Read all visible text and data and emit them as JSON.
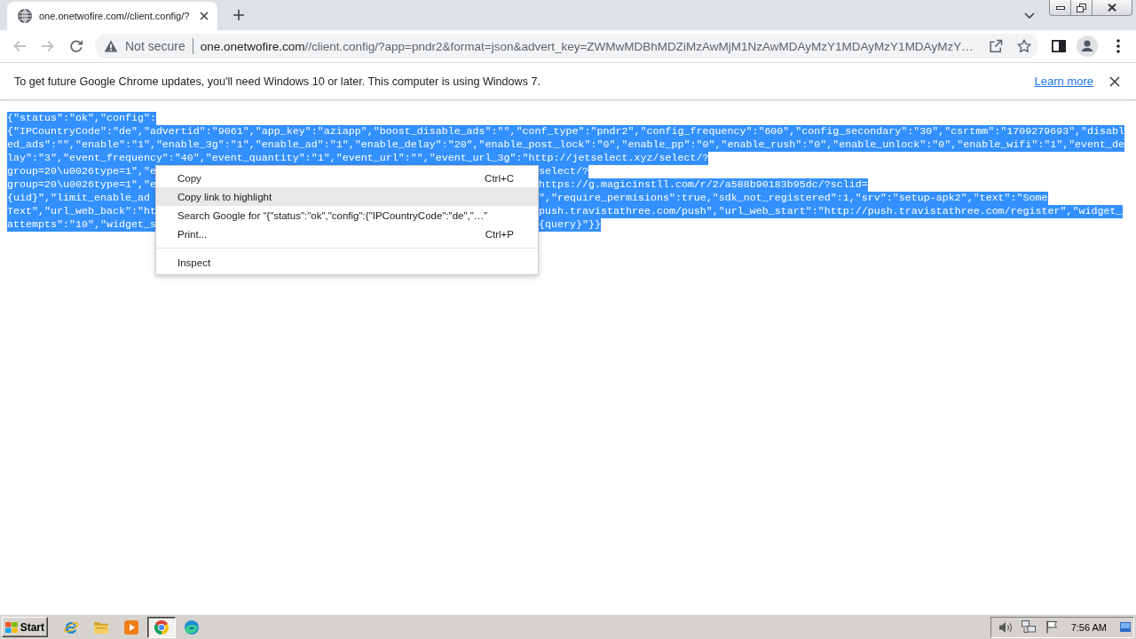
{
  "tabs": [
    {
      "title": "one.onetwofire.com//client.config/?",
      "selected": true
    }
  ],
  "toolbar": {
    "back": {
      "disabled": true
    },
    "forward": {
      "disabled": true
    }
  },
  "address_bar": {
    "security_label": "Not secure",
    "url_host": "one.onetwofire.com",
    "url_rest": "//client.config/?app=pndr2&format=json&advert_key=ZWMwMDBhMDZiMzAwMjM1NzAwMDAyMzY1MDAyMzY1MDAyMzY…"
  },
  "info_bar": {
    "message": "To get future Google Chrome updates, you'll need Windows 10 or later. This computer is using Windows 7.",
    "link": "Learn more"
  },
  "page": {
    "highlighted": true,
    "lines": [
      {
        "kind": "full",
        "text": "{\"status\":\"ok\",\"config\":"
      },
      {
        "kind": "full",
        "text": "{\"IPCountryCode\":\"de\",\"advertid\":\"9061\",\"app_key\":\"aziapp\",\"boost_disable_ads\":\"\",\"conf_type\":\"pndr2\",\"config_frequency\":\"600\",\"config_secondary\":\"30\",\"csrtmm\":\"1709279693\",\"disabl"
      },
      {
        "kind": "full",
        "text": "ed_ads\":\"\",\"enable\":\"1\",\"enable_3g\":\"1\",\"enable_ad\":\"1\",\"enable_delay\":\"20\",\"enable_post_lock\":\"0\",\"enable_pp\":\"0\",\"enable_rush\":\"0\",\"enable_unlock\":\"0\",\"enable_wifi\":\"1\",\"event_de"
      },
      {
        "kind": "full",
        "text": "lay\":\"3\",\"event_frequency\":\"40\",\"event_quantity\":\"1\",\"event_url\":\"\",\"event_url_3g\":\"http://jetselect.xyz/select/?"
      },
      {
        "kind": "split",
        "before_menu": "group=20\\u0026type=1\",\"e",
        "after_menu": "select/?"
      },
      {
        "kind": "split",
        "before_menu": "group=20\\u0026type=1\",\"e",
        "after_menu": "https://g.magicinstll.com/r/2/a588b90183b95dc/?sclid="
      },
      {
        "kind": "split",
        "before_menu": "{uid}\",\"limit_enable_ad",
        "after_menu": "\",\"require_permisions\":true,\"sdk_not_registered\":1,\"srv\":\"setup-apk2\",\"text\":\"Some"
      },
      {
        "kind": "split",
        "before_menu": "Text\",\"url_web_back\":\"ht",
        "after_menu": "push.travistathree.com/push\",\"url_web_start\":\"http://push.travistathree.com/register\",\"widget_"
      },
      {
        "kind": "split",
        "before_menu": "attempts\":\"10\",\"widget_s",
        "after_menu": "{query}\"}}"
      }
    ]
  },
  "context_menu": {
    "items": [
      {
        "kind": "command",
        "label": "Copy",
        "shortcut": "Ctrl+C",
        "hovered": false
      },
      {
        "kind": "command",
        "label": "Copy link to highlight",
        "hovered": true
      },
      {
        "kind": "command",
        "label": "Search Google for “{\"status\":\"ok\",\"config\":{\"IPCountryCode\":\"de\",\"…”",
        "hovered": false
      },
      {
        "kind": "command",
        "label": "Print...",
        "shortcut": "Ctrl+P",
        "hovered": false
      },
      {
        "kind": "separator"
      },
      {
        "kind": "command",
        "label": "Inspect",
        "hovered": false
      }
    ]
  },
  "taskbar": {
    "start_label": "Start",
    "apps": [
      {
        "kind": "ie",
        "active": false
      },
      {
        "kind": "folder",
        "active": false
      },
      {
        "kind": "player",
        "active": false
      },
      {
        "kind": "chrome",
        "active": true
      },
      {
        "kind": "edge",
        "active": false
      }
    ],
    "clock": "7:56 AM"
  }
}
